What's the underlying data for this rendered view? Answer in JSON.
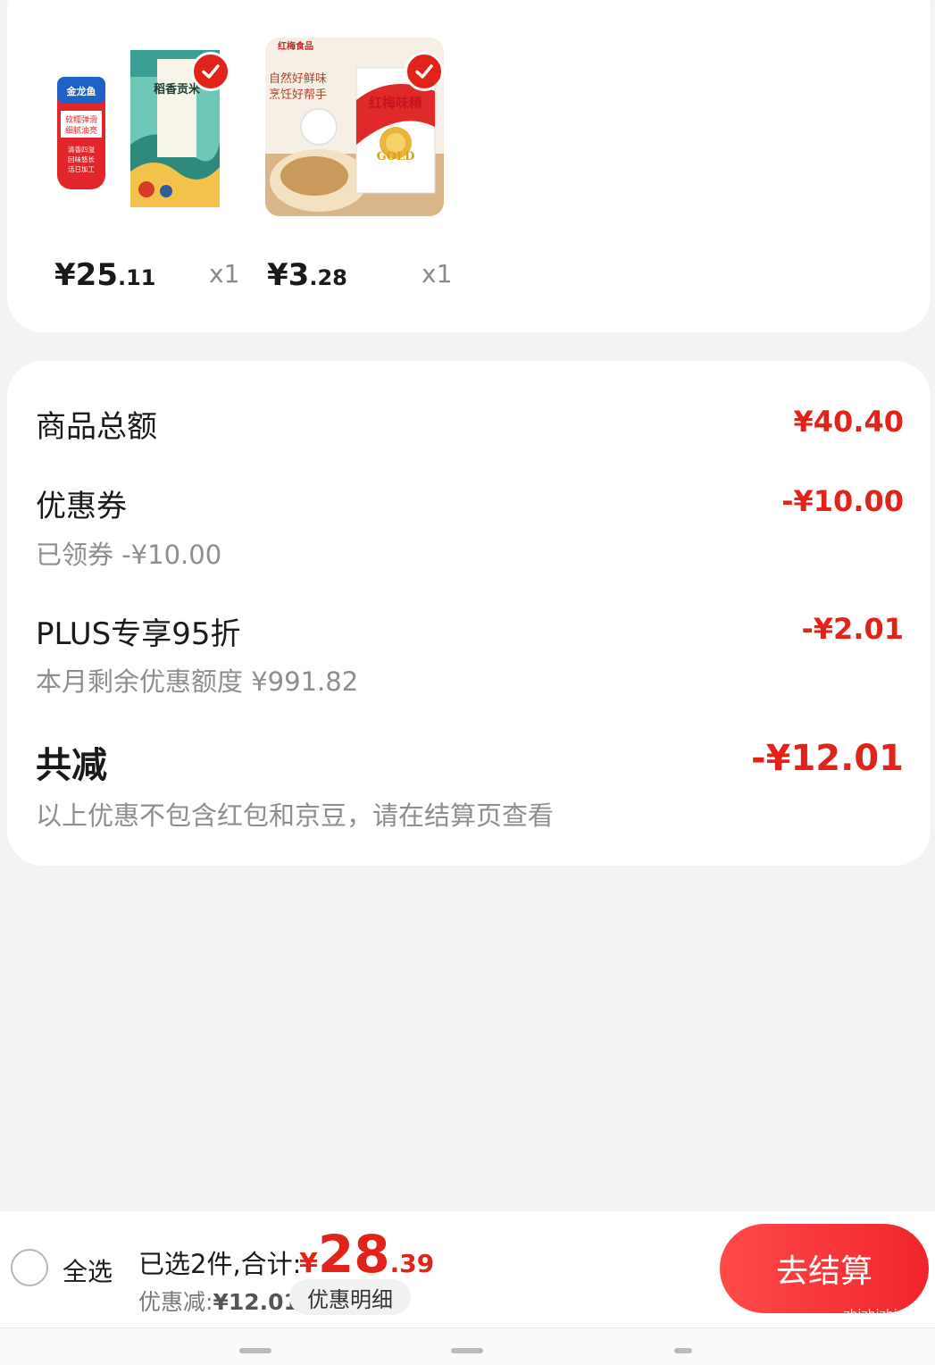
{
  "products": [
    {
      "name": "稻香贡米",
      "price_int": "¥25",
      "price_dec": ".11",
      "qty": "x1",
      "selected": true
    },
    {
      "name": "红梅味精",
      "price_int": "¥3",
      "price_dec": ".28",
      "qty": "x1",
      "selected": true
    }
  ],
  "product_art": {
    "rice_brand_tag": "金龙鱼",
    "rice_tag_line1": "软糯弹滑",
    "rice_tag_line2": "细腻油亮",
    "rice_tag_item1": "清香四溢",
    "rice_tag_item2": "回味悠长",
    "rice_tag_item3": "活日加工",
    "rice_bag_text": "稻香贡米",
    "msg_brand": "红梅食品",
    "msg_slogan1": "自然好鲜味",
    "msg_slogan2": "烹饪好帮手",
    "msg_bag_title": "红梅味精",
    "msg_bag_badge": "GOLD"
  },
  "summary": {
    "goods_total_label": "商品总额",
    "goods_total_value": "¥40.40",
    "coupon_label": "优惠券",
    "coupon_value": "-¥10.00",
    "coupon_sub": "已领券 -¥10.00",
    "plus_label": "PLUS专享95折",
    "plus_value": "-¥2.01",
    "plus_sub": "本月剩余优惠额度 ¥991.82",
    "total_reduction_label": "共减",
    "total_reduction_value": "-¥12.01",
    "note": "以上优惠不包含红包和京豆，请在结算页查看"
  },
  "bottom_bar": {
    "select_all_label": "全选",
    "selected_text": "已选2件,合计:",
    "total_symbol": "¥",
    "total_int": "28",
    "total_dec": ".39",
    "discount_label": "优惠减:",
    "discount_value": "¥12.01",
    "detail_button": "优惠明细",
    "checkout_button": "去结算",
    "watermark": "zhizhizhi.com"
  },
  "colors": {
    "accent": "#e2231a",
    "background": "#f3f3f3",
    "card": "#ffffff"
  }
}
